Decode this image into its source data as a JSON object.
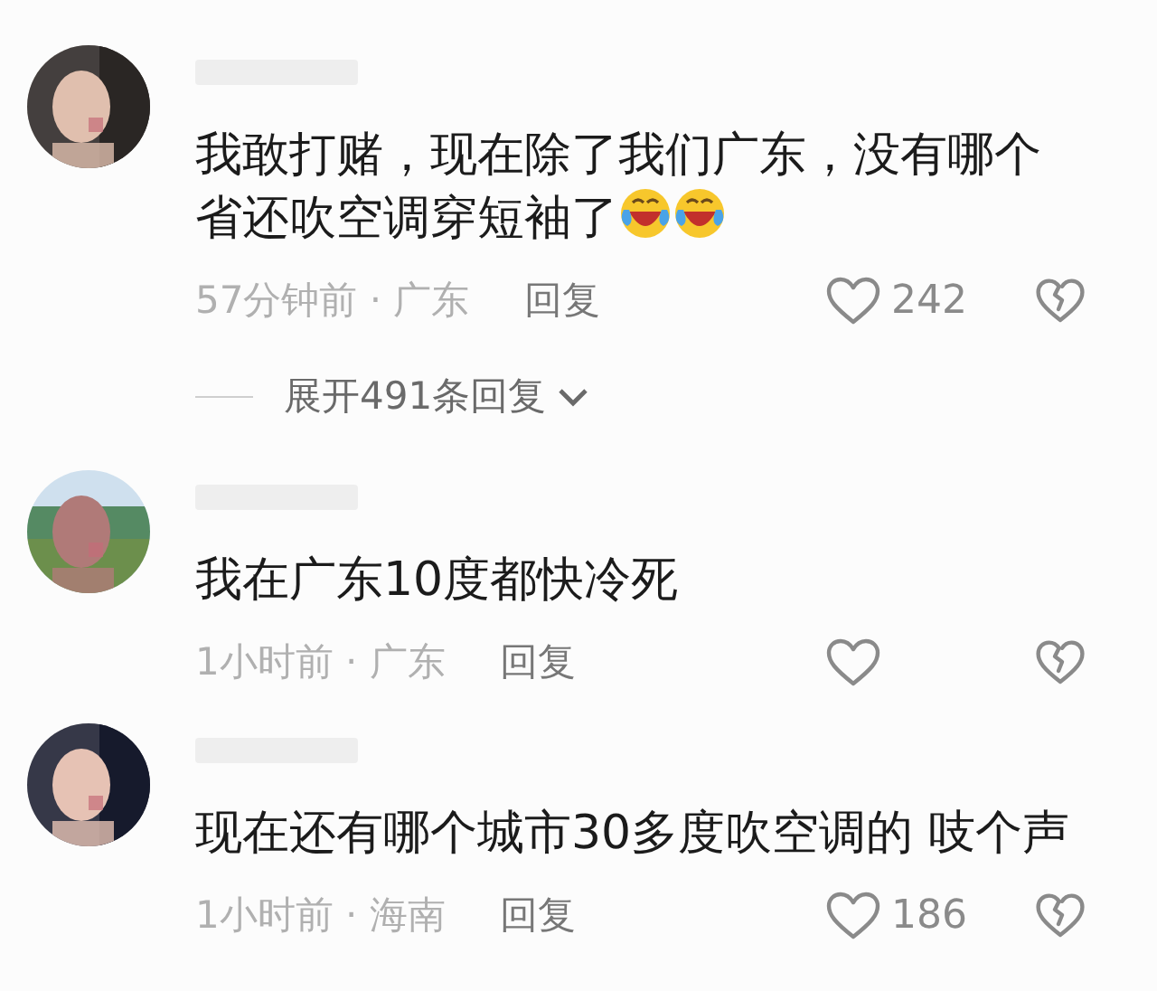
{
  "comments": [
    {
      "avatar": {
        "kind": "picture"
      },
      "text": "我敢打赌，现在除了我们广东，没有哪个省还吹空调穿短袖了",
      "emojis": [
        {
          "kind": "laughing-crying"
        },
        {
          "kind": "laughing-crying"
        }
      ],
      "meta": "57分钟前 · 广东",
      "reply": "回复",
      "likes": "242",
      "replies": {
        "label": "展开491条回复"
      }
    },
    {
      "avatar": {
        "kind": "picture"
      },
      "text": "我在广东10度都快冷死",
      "meta": "1小时前 · 广东",
      "reply": "回复"
    },
    {
      "avatar": {
        "kind": "picture"
      },
      "text": "现在还有哪个城市30多度吹空调的 吱个声",
      "meta": "1小时前 · 海南",
      "reply": "回复",
      "likes": "186"
    }
  ]
}
